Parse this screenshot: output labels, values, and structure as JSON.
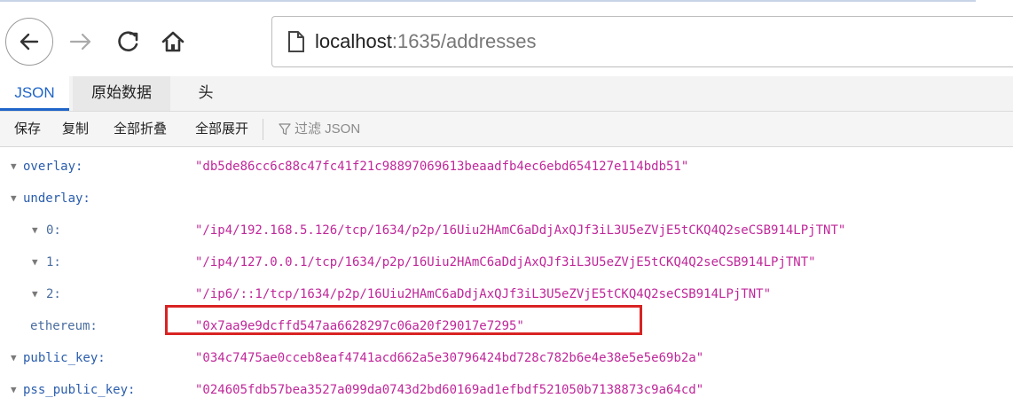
{
  "browser": {
    "url_host": "localhost",
    "url_path": ":1635/addresses"
  },
  "tabs": [
    {
      "label": "JSON"
    },
    {
      "label": "原始数据"
    },
    {
      "label": "头"
    }
  ],
  "toolbar": {
    "save": "保存",
    "copy": "复制",
    "collapse_all": "全部折叠",
    "expand_all": "全部展开",
    "filter_placeholder": "过滤 JSON"
  },
  "json": {
    "overlay": {
      "key": "overlay:",
      "value": "\"db5de86cc6c88c47fc41f21c98897069613beaadfb4ec6ebd654127e114bdb51\""
    },
    "underlay": {
      "key": "underlay:",
      "items": [
        {
          "key": "0:",
          "value": "\"/ip4/192.168.5.126/tcp/1634/p2p/16Uiu2HAmC6aDdjAxQJf3iL3U5eZVjE5tCKQ4Q2seCSB914LPjTNT\""
        },
        {
          "key": "1:",
          "value": "\"/ip4/127.0.0.1/tcp/1634/p2p/16Uiu2HAmC6aDdjAxQJf3iL3U5eZVjE5tCKQ4Q2seCSB914LPjTNT\""
        },
        {
          "key": "2:",
          "value": "\"/ip6/::1/tcp/1634/p2p/16Uiu2HAmC6aDdjAxQJf3iL3U5eZVjE5tCKQ4Q2seCSB914LPjTNT\""
        }
      ]
    },
    "ethereum": {
      "key": "ethereum:",
      "value": "\"0x7aa9e9dcffd547aa6628297c06a20f29017e7295\""
    },
    "public_key": {
      "key": "public_key:",
      "value": "\"034c7475ae0cceb8eaf4741acd662a5e30796424bd728c782b6e4e38e5e5e69b2a\""
    },
    "pss_public_key": {
      "key": "pss_public_key:",
      "value": "\"024605fdb57bea3527a099da0743d2bd60169ad1efbdf521050b7138873c9a64cd\""
    }
  },
  "colors": {
    "key": "#2a5dad",
    "string": "#c0279a",
    "active_tab": "#1f64c8",
    "highlight": "#d92323"
  }
}
